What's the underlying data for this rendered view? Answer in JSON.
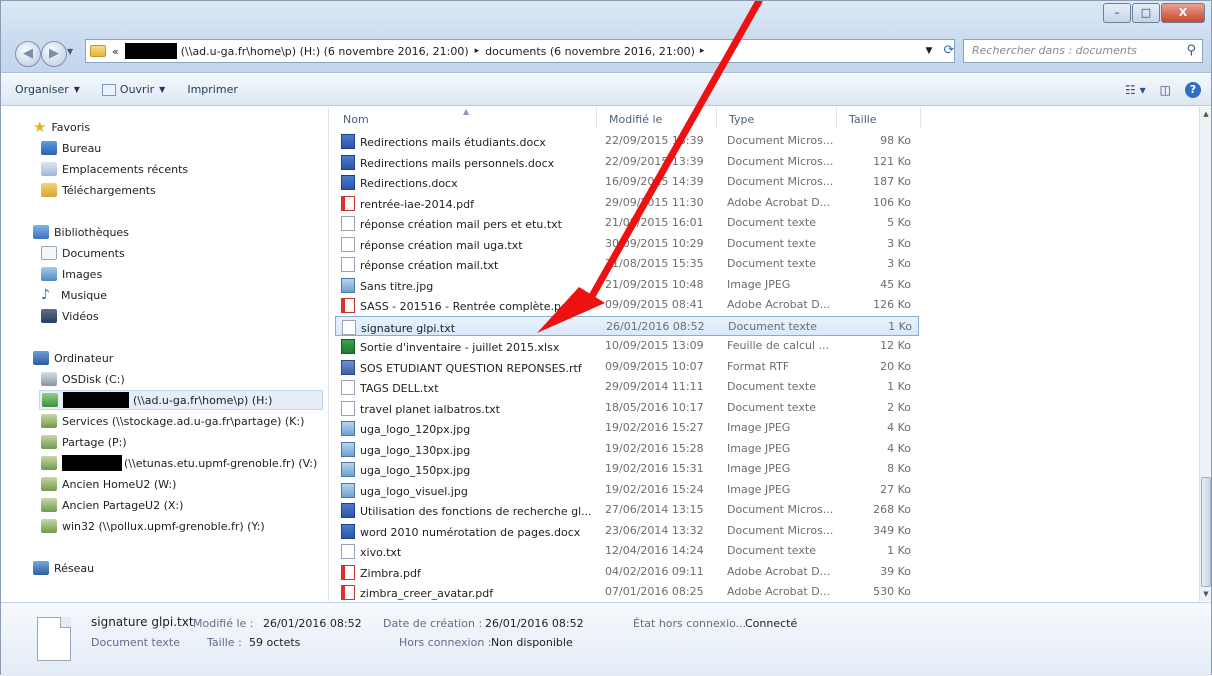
{
  "window": {
    "controls": {
      "minimize": "–",
      "maximize": "□",
      "close": "X"
    }
  },
  "address": {
    "prefix": "«",
    "segment1": "(\\\\ad.u-ga.fr\\home\\p) (H:) (6 novembre 2016, 21:00)",
    "sep1": "▸",
    "segment2": "documents (6 novembre 2016, 21:00)",
    "sep2": "▸"
  },
  "search": {
    "placeholder": "Rechercher dans : documents"
  },
  "toolbar": {
    "organiser": "Organiser",
    "ouvrir": "Ouvrir",
    "imprimer": "Imprimer"
  },
  "nav": {
    "favoris": "Favoris",
    "bureau": "Bureau",
    "emplacements": "Emplacements récents",
    "telechargements": "Téléchargements",
    "bibliotheques": "Bibliothèques",
    "documents": "Documents",
    "images": "Images",
    "musique": "Musique",
    "videos": "Vidéos",
    "ordinateur": "Ordinateur",
    "osdisk": "OSDisk (C:)",
    "homedrive": "(\\\\ad.u-ga.fr\\home\\p) (H:)",
    "services": "Services (\\\\stockage.ad.u-ga.fr\\partage) (K:)",
    "partage": "Partage (P:)",
    "etunas": "(\\\\etunas.etu.upmf-grenoble.fr) (V:)",
    "ancienhome": "Ancien HomeU2 (W:)",
    "ancienpartage": "Ancien PartageU2 (X:)",
    "win32": "win32 (\\\\pollux.upmf-grenoble.fr) (Y:)",
    "reseau": "Réseau"
  },
  "columns": {
    "name": "Nom",
    "date": "Modifié le",
    "type": "Type",
    "size": "Taille"
  },
  "files": [
    {
      "name": "Redirections mails étudiants.docx",
      "date": "22/09/2015 13:39",
      "type": "Document Micros...",
      "size": "98 Ko",
      "icon": "word"
    },
    {
      "name": "Redirections mails personnels.docx",
      "date": "22/09/2015 13:39",
      "type": "Document Micros...",
      "size": "121 Ko",
      "icon": "word"
    },
    {
      "name": "Redirections.docx",
      "date": "16/09/2015 14:39",
      "type": "Document Micros...",
      "size": "187 Ko",
      "icon": "word"
    },
    {
      "name": "rentrée-iae-2014.pdf",
      "date": "29/09/2015 11:30",
      "type": "Adobe Acrobat D...",
      "size": "106 Ko",
      "icon": "pdf"
    },
    {
      "name": "réponse création mail pers et etu.txt",
      "date": "21/09/2015 16:01",
      "type": "Document texte",
      "size": "5 Ko",
      "icon": "txt"
    },
    {
      "name": "réponse création mail uga.txt",
      "date": "30/09/2015 10:29",
      "type": "Document texte",
      "size": "3 Ko",
      "icon": "txt"
    },
    {
      "name": "réponse création mail.txt",
      "date": "21/08/2015 15:35",
      "type": "Document texte",
      "size": "3 Ko",
      "icon": "txt"
    },
    {
      "name": "Sans titre.jpg",
      "date": "21/09/2015 10:48",
      "type": "Image JPEG",
      "size": "45 Ko",
      "icon": "img"
    },
    {
      "name": "SASS - 201516 - Rentrée complète.pdf",
      "date": "09/09/2015 08:41",
      "type": "Adobe Acrobat D...",
      "size": "126 Ko",
      "icon": "pdf"
    },
    {
      "name": "signature glpi.txt",
      "date": "26/01/2016 08:52",
      "type": "Document texte",
      "size": "1 Ko",
      "icon": "txt",
      "selected": true
    },
    {
      "name": "Sortie d'inventaire - juillet 2015.xlsx",
      "date": "10/09/2015 13:09",
      "type": "Feuille de calcul ...",
      "size": "12 Ko",
      "icon": "excel"
    },
    {
      "name": "SOS ETUDIANT QUESTION REPONSES.rtf",
      "date": "09/09/2015 10:07",
      "type": "Format RTF",
      "size": "20 Ko",
      "icon": "rtf"
    },
    {
      "name": "TAGS DELL.txt",
      "date": "29/09/2014 11:11",
      "type": "Document texte",
      "size": "1 Ko",
      "icon": "txt"
    },
    {
      "name": "travel planet ialbatros.txt",
      "date": "18/05/2016 10:17",
      "type": "Document texte",
      "size": "2 Ko",
      "icon": "txt"
    },
    {
      "name": "uga_logo_120px.jpg",
      "date": "19/02/2016 15:27",
      "type": "Image JPEG",
      "size": "4 Ko",
      "icon": "img"
    },
    {
      "name": "uga_logo_130px.jpg",
      "date": "19/02/2016 15:28",
      "type": "Image JPEG",
      "size": "4 Ko",
      "icon": "img"
    },
    {
      "name": "uga_logo_150px.jpg",
      "date": "19/02/2016 15:31",
      "type": "Image JPEG",
      "size": "8 Ko",
      "icon": "img"
    },
    {
      "name": "uga_logo_visuel.jpg",
      "date": "19/02/2016 15:24",
      "type": "Image JPEG",
      "size": "27 Ko",
      "icon": "img"
    },
    {
      "name": "Utilisation des fonctions de recherche gl...",
      "date": "27/06/2014 13:15",
      "type": "Document Micros...",
      "size": "268 Ko",
      "icon": "word"
    },
    {
      "name": "word 2010 numérotation de pages.docx",
      "date": "23/06/2014 13:32",
      "type": "Document Micros...",
      "size": "349 Ko",
      "icon": "word"
    },
    {
      "name": "xivo.txt",
      "date": "12/04/2016 14:24",
      "type": "Document texte",
      "size": "1 Ko",
      "icon": "txt"
    },
    {
      "name": "Zimbra.pdf",
      "date": "04/02/2016 09:11",
      "type": "Adobe Acrobat D...",
      "size": "39 Ko",
      "icon": "pdf"
    },
    {
      "name": "zimbra_creer_avatar.pdf",
      "date": "07/01/2016 08:25",
      "type": "Adobe Acrobat D...",
      "size": "530 Ko",
      "icon": "pdf"
    }
  ],
  "details": {
    "filename": "signature glpi.txt",
    "modified_label": "Modifié le :",
    "modified_value": "26/01/2016 08:52",
    "type": "Document texte",
    "size_label": "Taille :",
    "size_value": "59 octets",
    "created_label": "Date de création :",
    "created_value": "26/01/2016 08:52",
    "offline_label": "Hors connexion :",
    "offline_value": "Non disponible",
    "state_label": "État hors connexio...",
    "state_value": "Connecté"
  },
  "colors": {
    "annotation": "#ee1111",
    "selection": "#d9e8fb"
  }
}
